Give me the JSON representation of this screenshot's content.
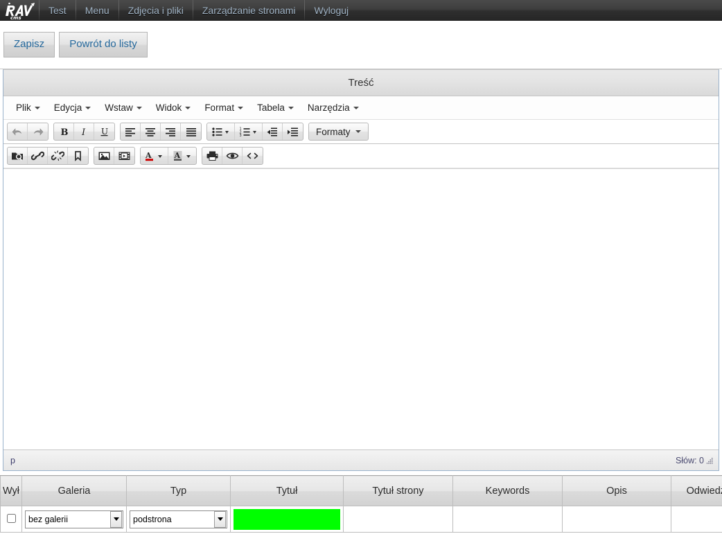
{
  "nav": {
    "logo_alt": "RAV cms",
    "items": [
      {
        "label": "Test"
      },
      {
        "label": "Menu"
      },
      {
        "label": "Zdjęcia i pliki"
      },
      {
        "label": "Zarządzanie stronami"
      },
      {
        "label": "Wyloguj"
      }
    ]
  },
  "actions": {
    "save_label": "Zapisz",
    "back_label": "Powrót do listy"
  },
  "editor": {
    "title": "Treść",
    "menu": [
      {
        "label": "Plik"
      },
      {
        "label": "Edycja"
      },
      {
        "label": "Wstaw"
      },
      {
        "label": "Widok"
      },
      {
        "label": "Format"
      },
      {
        "label": "Tabela"
      },
      {
        "label": "Narzędzia"
      }
    ],
    "toolbar_row1": [
      {
        "name": "undo-icon",
        "title": "Cofnij"
      },
      {
        "name": "redo-icon",
        "title": "Ponów"
      },
      {
        "name": "bold-icon",
        "title": "Pogrubienie"
      },
      {
        "name": "italic-icon",
        "title": "Kursywa"
      },
      {
        "name": "underline-icon",
        "title": "Podkreślenie"
      },
      {
        "name": "align-left-icon",
        "title": "Wyrównaj do lewej"
      },
      {
        "name": "align-center-icon",
        "title": "Wyśrodkuj"
      },
      {
        "name": "align-right-icon",
        "title": "Wyrównaj do prawej"
      },
      {
        "name": "align-justify-icon",
        "title": "Wyjustuj"
      },
      {
        "name": "bullet-list-icon",
        "title": "Lista punktowana"
      },
      {
        "name": "numbered-list-icon",
        "title": "Lista numerowana"
      },
      {
        "name": "outdent-icon",
        "title": "Zmniejsz wcięcie"
      },
      {
        "name": "indent-icon",
        "title": "Zwiększ wcięcie"
      }
    ],
    "formats_label": "Formaty",
    "toolbar_row2": [
      {
        "name": "browse-files-icon",
        "title": "Przeglądaj"
      },
      {
        "name": "link-icon",
        "title": "Wstaw link"
      },
      {
        "name": "unlink-icon",
        "title": "Usuń link"
      },
      {
        "name": "anchor-icon",
        "title": "Kotwica"
      },
      {
        "name": "image-icon",
        "title": "Wstaw obraz"
      },
      {
        "name": "media-icon",
        "title": "Wstaw media"
      },
      {
        "name": "text-color-icon",
        "title": "Kolor tekstu"
      },
      {
        "name": "background-color-icon",
        "title": "Kolor tła"
      },
      {
        "name": "print-icon",
        "title": "Drukuj"
      },
      {
        "name": "preview-icon",
        "title": "Podgląd"
      },
      {
        "name": "source-code-icon",
        "title": "Kod źródłowy"
      }
    ],
    "content": "",
    "status_path": "p",
    "status_words": "Słów: 0"
  },
  "grid": {
    "headers": [
      "Wył",
      "Galeria",
      "Typ",
      "Tytuł",
      "Tytuł strony",
      "Keywords",
      "Opis",
      "Odwiedzin"
    ],
    "row": {
      "disabled_checked": false,
      "gallery_value": "bez galerii",
      "gallery_options": [
        "bez galerii"
      ],
      "type_value": "podstrona",
      "type_options": [
        "podstrona"
      ],
      "title_value": "",
      "page_title_value": "",
      "keywords_value": "",
      "description_value": "",
      "visits_value": ""
    }
  },
  "colors": {
    "accent_green": "#00ff00",
    "link_blue": "#24689c",
    "nav_text": "#9fb2c4"
  }
}
